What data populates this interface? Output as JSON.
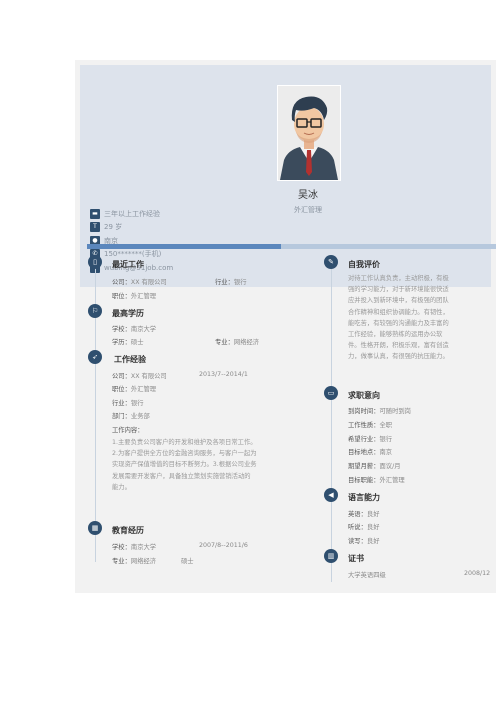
{
  "contact": [
    {
      "icon": "briefcase-icon",
      "glyph": "▬",
      "text": "三年以上工作经验"
    },
    {
      "icon": "person-icon",
      "glyph": "T",
      "text": "29 岁"
    },
    {
      "icon": "location-icon",
      "glyph": "●",
      "text": "南京"
    },
    {
      "icon": "phone-icon",
      "glyph": "✆",
      "text": "150*******(手机)"
    },
    {
      "icon": "email-icon",
      "glyph": "✉",
      "text": "wubing@51job.com"
    }
  ],
  "profile": {
    "name": "吴冰",
    "title": "外汇管理"
  },
  "left": {
    "recent_job": {
      "heading": "最近工作",
      "company_label": "公司：",
      "company": "XX 有限公司",
      "industry_label": "行业：",
      "industry": "银行",
      "position_label": "职位：",
      "position": "外汇管理"
    },
    "top_edu": {
      "heading": "最高学历",
      "school_label": "学校：",
      "school": "南京大学",
      "degree_label": "学历：",
      "degree": "硕士",
      "major_label": "专业：",
      "major": "网络经济"
    },
    "work": {
      "heading": "工作经验",
      "company_label": "公司：",
      "company": "XX 有限公司",
      "period": "2013/7--2014/1",
      "position_label": "职位：",
      "position": "外汇管理",
      "industry_label": "行业：",
      "industry": "银行",
      "dept_label": "部门：",
      "dept": "业务部",
      "content_label": "工作内容：",
      "content_lines": [
        "1.主要负责公司客户的开发和维护及各项日常工作。",
        "2.为客户提供全方位的金融咨询服务，与客户一起为",
        "实现资产保值增值的目标不断努力。3.根据公司业务",
        "发展需要开发客户，具备独立策划实施营销活动的",
        "能力。"
      ]
    },
    "education": {
      "heading": "教育经历",
      "school_label": "学校：",
      "school": "南京大学",
      "period": "2007/8--2011/6",
      "major_label": "专业：",
      "major": "网络经济",
      "degree": "硕士"
    }
  },
  "right": {
    "self_eval": {
      "heading": "自我评价",
      "lines": [
        "对待工作认真负责，主动积极，有极",
        "强的学习能力，对于新环境能很快适",
        "应并投入到新环境中，有极强的团队",
        "合作精神和组织协调能力。有韧性，",
        "能吃苦，有较强的沟通能力及丰富的",
        "工作经验，能够熟练的运用办公软",
        "件。性格开朗，积极乐观，富有创造",
        "力，做事认真，有很强的抗压能力。"
      ]
    },
    "intent": {
      "heading": "求职意向",
      "rows": [
        {
          "label": "到岗时间：",
          "value": "可随时到岗"
        },
        {
          "label": "工作性质：",
          "value": "全职"
        },
        {
          "label": "希望行业：",
          "value": "银行"
        },
        {
          "label": "目标地点：",
          "value": "南京"
        },
        {
          "label": "期望月薪：",
          "value": "面议/月"
        },
        {
          "label": "目标职能：",
          "value": "外汇管理"
        }
      ]
    },
    "language": {
      "heading": "语言能力",
      "rows": [
        {
          "label": "英语：",
          "value": "良好"
        },
        {
          "label": "听说：",
          "value": "良好"
        },
        {
          "label": "读写：",
          "value": "良好"
        }
      ]
    },
    "cert": {
      "heading": "证书",
      "name": "大学英语四级",
      "date": "2008/12"
    }
  }
}
